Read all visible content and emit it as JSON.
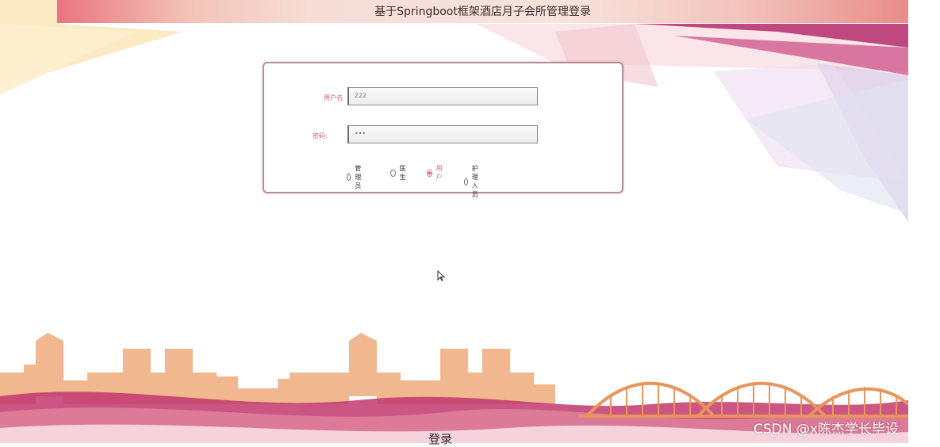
{
  "page": {
    "title": "基于Springboot框架酒店月子会所管理登录"
  },
  "login_form": {
    "username_label": "用户名",
    "username_value": "222",
    "password_label": "密码:",
    "password_value": "•••",
    "roles": [
      {
        "label": "管理员",
        "checked": false
      },
      {
        "label": "医生",
        "checked": false
      },
      {
        "label": "用户",
        "checked": true
      },
      {
        "label": "护理人员",
        "checked": false
      }
    ],
    "login_button": "登录"
  },
  "watermark": "CSDN @x陈杰学长毕设",
  "colors": {
    "accent": "#c6646c",
    "card_border": "#b58e93",
    "bridge": "#e8955a",
    "skyline": "#f1b48a",
    "magenta_band": "#b52e6e"
  }
}
